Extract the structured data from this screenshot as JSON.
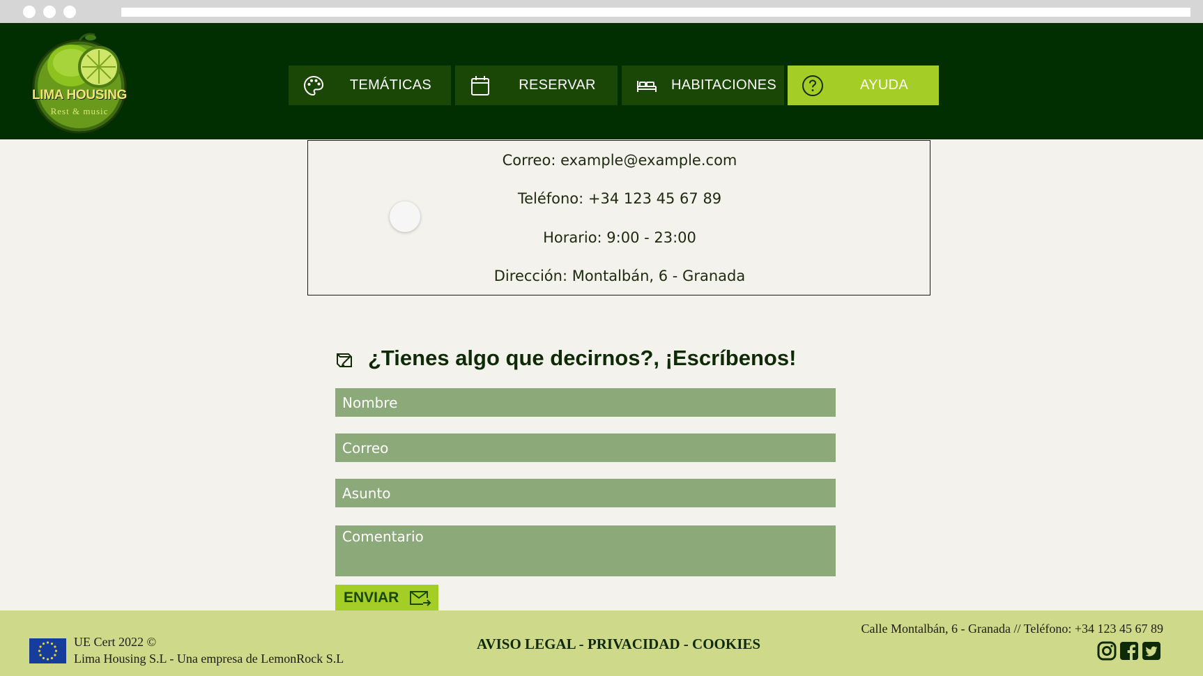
{
  "brand": {
    "name": "LIMA HOUSING",
    "tagline": "Rest & music"
  },
  "nav": {
    "items": [
      {
        "label": "TEMÁTICAS",
        "icon": "palette-icon"
      },
      {
        "label": "RESERVAR",
        "icon": "calendar-icon"
      },
      {
        "label": "HABITACIONES",
        "icon": "bed-icon"
      },
      {
        "label": "AYUDA",
        "icon": "question-circle-icon",
        "active": true
      }
    ]
  },
  "contact": {
    "email": "Correo: example@example.com",
    "phone": "Teléfono: +34 123 45 67 89",
    "hours": "Horario: 9:00 - 23:00",
    "address": "Dirección: Montalbán, 6 - Granada"
  },
  "form": {
    "title": "¿Tienes algo que decirnos?, ¡Escríbenos!",
    "name_placeholder": "Nombre",
    "email_placeholder": "Correo",
    "subject_placeholder": "Asunto",
    "comment_placeholder": "Comentario",
    "submit_label": "ENVIAR"
  },
  "footer": {
    "cert_line1": "UE Cert 2022 ©",
    "cert_line2": "Lima Housing S.L - Una empresa de LemonRock S.L",
    "legal": "AVISO LEGAL",
    "privacy": "PRIVACIDAD",
    "cookies": "COOKIES",
    "separator": " - ",
    "address_phone": "Calle Montalbán, 6 - Granada  // Teléfono: +34 123 45 67 89"
  },
  "colors": {
    "header_bg": "#022f02",
    "nav_bg": "#1a4705",
    "nav_active": "#a4cd25",
    "field_bg": "#8ca97a",
    "footer_bg": "#cfd98a",
    "page_bg": "#f4f2ec"
  }
}
